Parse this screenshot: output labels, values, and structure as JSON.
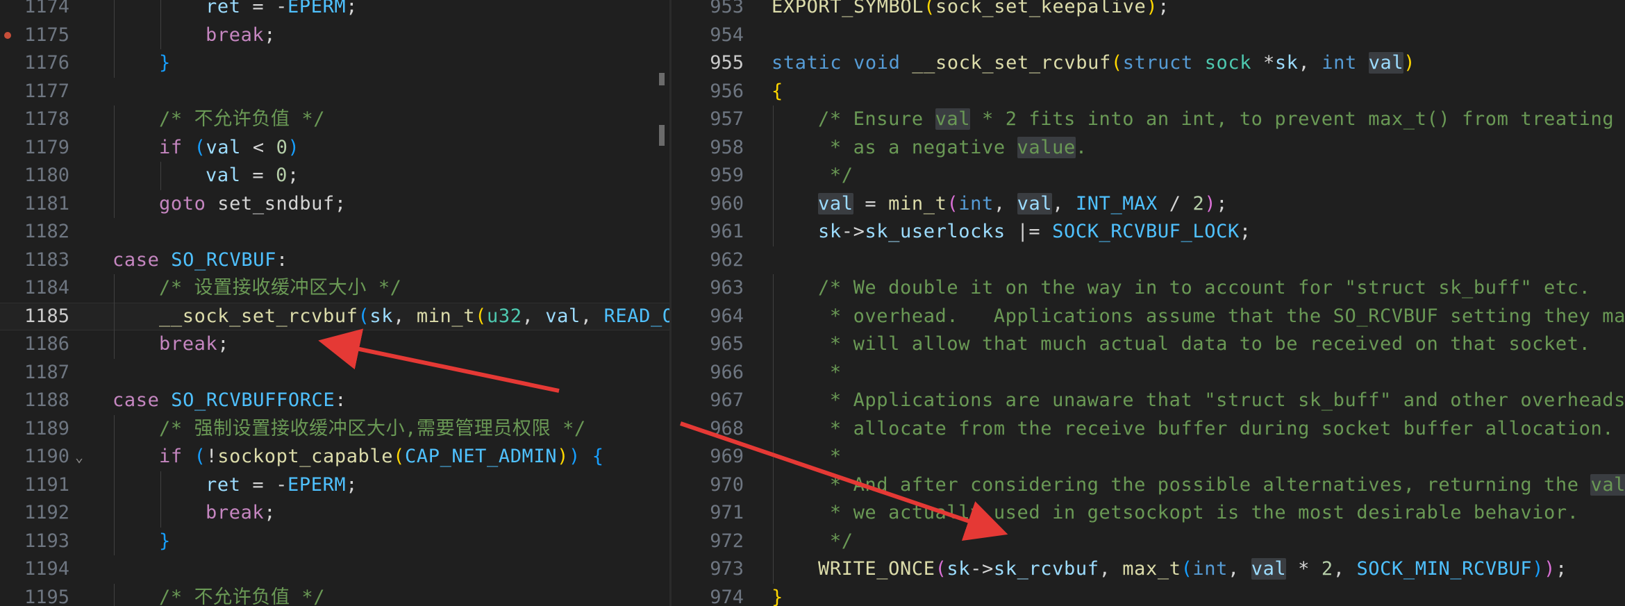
{
  "left": {
    "lines": [
      {
        "n": "1174",
        "breakpoint": false,
        "fold": false,
        "indent": 2,
        "tokens": [
          [
            "ret",
            "var"
          ],
          [
            " = -",
            "op"
          ],
          [
            "EPERM",
            "macro"
          ],
          [
            ";",
            "op"
          ]
        ]
      },
      {
        "n": "1175",
        "breakpoint": true,
        "fold": false,
        "indent": 2,
        "tokens": [
          [
            "break",
            "kw"
          ],
          [
            ";",
            "op"
          ]
        ]
      },
      {
        "n": "1176",
        "breakpoint": false,
        "fold": false,
        "indent": 1,
        "tokens": [
          [
            "}",
            "b3"
          ]
        ]
      },
      {
        "n": "1177",
        "breakpoint": false,
        "fold": false,
        "indent": 0,
        "tokens": []
      },
      {
        "n": "1178",
        "breakpoint": false,
        "fold": false,
        "indent": 1,
        "tokens": [
          [
            "/* 不允许负值 */",
            "cm"
          ]
        ]
      },
      {
        "n": "1179",
        "breakpoint": false,
        "fold": false,
        "indent": 1,
        "tokens": [
          [
            "if",
            "kw"
          ],
          [
            " ",
            "op"
          ],
          [
            "(",
            "b3"
          ],
          [
            "val",
            "var"
          ],
          [
            " < ",
            "op"
          ],
          [
            "0",
            "num"
          ],
          [
            ")",
            "b3"
          ]
        ]
      },
      {
        "n": "1180",
        "breakpoint": false,
        "fold": false,
        "indent": 2,
        "tokens": [
          [
            "val",
            "var"
          ],
          [
            " = ",
            "op"
          ],
          [
            "0",
            "num"
          ],
          [
            ";",
            "op"
          ]
        ]
      },
      {
        "n": "1181",
        "breakpoint": false,
        "fold": false,
        "indent": 1,
        "tokens": [
          [
            "goto",
            "kw"
          ],
          [
            " set_sndbuf;",
            "op"
          ]
        ]
      },
      {
        "n": "1182",
        "breakpoint": false,
        "fold": false,
        "indent": 0,
        "tokens": []
      },
      {
        "n": "1183",
        "breakpoint": false,
        "fold": false,
        "indent": 0,
        "tokens": [
          [
            "case",
            "kw"
          ],
          [
            " ",
            "op"
          ],
          [
            "SO_RCVBUF",
            "macro"
          ],
          [
            ":",
            "op"
          ]
        ]
      },
      {
        "n": "1184",
        "breakpoint": false,
        "fold": false,
        "indent": 1,
        "tokens": [
          [
            "/* 设置接收缓冲区大小 */",
            "cm"
          ]
        ]
      },
      {
        "n": "1185",
        "breakpoint": false,
        "fold": false,
        "indent": 1,
        "current": true,
        "tokens": [
          [
            "__sock_set_rcvbuf",
            "fn"
          ],
          [
            "(",
            "b3"
          ],
          [
            "sk",
            "var"
          ],
          [
            ", ",
            "op"
          ],
          [
            "min_t",
            "fn"
          ],
          [
            "(",
            "b1"
          ],
          [
            "u32",
            "struct"
          ],
          [
            ", ",
            "op"
          ],
          [
            "val",
            "var"
          ],
          [
            ", ",
            "op"
          ],
          [
            "READ_ONCE(",
            "macro"
          ]
        ]
      },
      {
        "n": "1186",
        "breakpoint": false,
        "fold": false,
        "indent": 1,
        "tokens": [
          [
            "break",
            "kw"
          ],
          [
            ";",
            "op"
          ]
        ]
      },
      {
        "n": "1187",
        "breakpoint": false,
        "fold": false,
        "indent": 0,
        "tokens": []
      },
      {
        "n": "1188",
        "breakpoint": false,
        "fold": false,
        "indent": 0,
        "tokens": [
          [
            "case",
            "kw"
          ],
          [
            " ",
            "op"
          ],
          [
            "SO_RCVBUFFORCE",
            "macro"
          ],
          [
            ":",
            "op"
          ]
        ]
      },
      {
        "n": "1189",
        "breakpoint": false,
        "fold": false,
        "indent": 1,
        "tokens": [
          [
            "/* 强制设置接收缓冲区大小,需要管理员权限 */",
            "cm"
          ]
        ]
      },
      {
        "n": "1190",
        "breakpoint": false,
        "fold": true,
        "indent": 1,
        "tokens": [
          [
            "if",
            "kw"
          ],
          [
            " ",
            "op"
          ],
          [
            "(",
            "b3"
          ],
          [
            "!",
            "op"
          ],
          [
            "sockopt_capable",
            "fn"
          ],
          [
            "(",
            "b1"
          ],
          [
            "CAP_NET_ADMIN",
            "macro"
          ],
          [
            ")",
            "b1"
          ],
          [
            ")",
            "b3"
          ],
          [
            " ",
            "op"
          ],
          [
            "{",
            "b3"
          ]
        ]
      },
      {
        "n": "1191",
        "breakpoint": false,
        "fold": false,
        "indent": 2,
        "tokens": [
          [
            "ret",
            "var"
          ],
          [
            " = -",
            "op"
          ],
          [
            "EPERM",
            "macro"
          ],
          [
            ";",
            "op"
          ]
        ]
      },
      {
        "n": "1192",
        "breakpoint": false,
        "fold": false,
        "indent": 2,
        "tokens": [
          [
            "break",
            "kw"
          ],
          [
            ";",
            "op"
          ]
        ]
      },
      {
        "n": "1193",
        "breakpoint": false,
        "fold": false,
        "indent": 1,
        "tokens": [
          [
            "}",
            "b3"
          ]
        ]
      },
      {
        "n": "1194",
        "breakpoint": false,
        "fold": false,
        "indent": 0,
        "tokens": []
      },
      {
        "n": "1195",
        "breakpoint": false,
        "fold": false,
        "indent": 1,
        "tokens": [
          [
            "/* 不允许负值 */",
            "cm"
          ]
        ]
      }
    ]
  },
  "right": {
    "lines": [
      {
        "n": "953",
        "indent": 0,
        "tokens": [
          [
            "EXPORT_SYMBOL",
            "fn"
          ],
          [
            "(",
            "b1"
          ],
          [
            "sock_set_keepalive",
            "fn"
          ],
          [
            ")",
            "b1"
          ],
          [
            ";",
            "op"
          ]
        ]
      },
      {
        "n": "954",
        "indent": 0,
        "tokens": []
      },
      {
        "n": "955",
        "indent": 0,
        "active": true,
        "tokens": [
          [
            "static",
            "type"
          ],
          [
            " ",
            "op"
          ],
          [
            "void",
            "type"
          ],
          [
            " ",
            "op"
          ],
          [
            "__sock_set_rcvbuf",
            "fn"
          ],
          [
            "(",
            "b1"
          ],
          [
            "struct",
            "type"
          ],
          [
            " ",
            "op"
          ],
          [
            "sock",
            "struct"
          ],
          [
            " *",
            "op"
          ],
          [
            "sk",
            "var"
          ],
          [
            ", ",
            "op"
          ],
          [
            "int",
            "type"
          ],
          [
            " ",
            "op"
          ],
          [
            "val",
            "var hl"
          ],
          [
            ")",
            "b1"
          ]
        ]
      },
      {
        "n": "956",
        "indent": 0,
        "tokens": [
          [
            "{",
            "b1"
          ]
        ]
      },
      {
        "n": "957",
        "indent": 1,
        "tokens": [
          [
            "/* Ensure ",
            "cm"
          ],
          [
            "val",
            "cm hl"
          ],
          [
            " * 2 fits into an int, to prevent max_t() from treating it",
            "cm"
          ]
        ]
      },
      {
        "n": "958",
        "indent": 1,
        "tokens": [
          [
            " * as a negative ",
            "cm"
          ],
          [
            "value",
            "cm hl"
          ],
          [
            ".",
            "cm"
          ]
        ]
      },
      {
        "n": "959",
        "indent": 1,
        "tokens": [
          [
            " */",
            "cm"
          ]
        ]
      },
      {
        "n": "960",
        "indent": 1,
        "tokens": [
          [
            "val",
            "var hl"
          ],
          [
            " = ",
            "op"
          ],
          [
            "min_t",
            "fn"
          ],
          [
            "(",
            "b2"
          ],
          [
            "int",
            "type"
          ],
          [
            ", ",
            "op"
          ],
          [
            "val",
            "var hl"
          ],
          [
            ", ",
            "op"
          ],
          [
            "INT_MAX",
            "macro"
          ],
          [
            " / ",
            "op"
          ],
          [
            "2",
            "num"
          ],
          [
            ")",
            "b2"
          ],
          [
            ";",
            "op"
          ]
        ]
      },
      {
        "n": "961",
        "indent": 1,
        "tokens": [
          [
            "sk",
            "var"
          ],
          [
            "->",
            "op"
          ],
          [
            "sk_userlocks",
            "var"
          ],
          [
            " |= ",
            "op"
          ],
          [
            "SOCK_RCVBUF_LOCK",
            "macro"
          ],
          [
            ";",
            "op"
          ]
        ]
      },
      {
        "n": "962",
        "indent": 0,
        "tokens": []
      },
      {
        "n": "963",
        "indent": 1,
        "tokens": [
          [
            "/* We double it on the way in to account for \"struct sk_buff\" etc.",
            "cm"
          ]
        ]
      },
      {
        "n": "964",
        "indent": 1,
        "tokens": [
          [
            " * overhead.   Applications assume that the SO_RCVBUF setting they make",
            "cm"
          ]
        ]
      },
      {
        "n": "965",
        "indent": 1,
        "tokens": [
          [
            " * will allow that much actual data to be received on that socket.",
            "cm"
          ]
        ]
      },
      {
        "n": "966",
        "indent": 1,
        "tokens": [
          [
            " *",
            "cm"
          ]
        ]
      },
      {
        "n": "967",
        "indent": 1,
        "tokens": [
          [
            " * Applications are unaware that \"struct sk_buff\" and other overheads",
            "cm"
          ]
        ]
      },
      {
        "n": "968",
        "indent": 1,
        "tokens": [
          [
            " * allocate from the receive buffer during socket buffer allocation.",
            "cm"
          ]
        ]
      },
      {
        "n": "969",
        "indent": 1,
        "tokens": [
          [
            " *",
            "cm"
          ]
        ]
      },
      {
        "n": "970",
        "indent": 1,
        "tokens": [
          [
            " * And after considering the possible alternatives, returning the ",
            "cm"
          ],
          [
            "value",
            "cm hl"
          ]
        ]
      },
      {
        "n": "971",
        "indent": 1,
        "tokens": [
          [
            " * we actually used in getsockopt is the most desirable behavior.",
            "cm"
          ]
        ]
      },
      {
        "n": "972",
        "indent": 1,
        "tokens": [
          [
            " */",
            "cm"
          ]
        ]
      },
      {
        "n": "973",
        "indent": 1,
        "tokens": [
          [
            "WRITE_ONCE",
            "fn"
          ],
          [
            "(",
            "b2"
          ],
          [
            "sk",
            "var"
          ],
          [
            "->",
            "op"
          ],
          [
            "sk_rcvbuf",
            "var"
          ],
          [
            ", ",
            "op"
          ],
          [
            "max_t",
            "fn"
          ],
          [
            "(",
            "b3"
          ],
          [
            "int",
            "type"
          ],
          [
            ", ",
            "op"
          ],
          [
            "val",
            "var hl"
          ],
          [
            " * ",
            "op"
          ],
          [
            "2",
            "num"
          ],
          [
            ", ",
            "op"
          ],
          [
            "SOCK_MIN_RCVBUF",
            "macro"
          ],
          [
            ")",
            "b3"
          ],
          [
            ")",
            "b2"
          ],
          [
            ";",
            "op"
          ]
        ]
      },
      {
        "n": "974",
        "indent": 0,
        "tokens": [
          [
            "}",
            "b1"
          ]
        ]
      }
    ]
  },
  "theme": {
    "background": "#1f1f1f",
    "arrow": "#e53935"
  }
}
